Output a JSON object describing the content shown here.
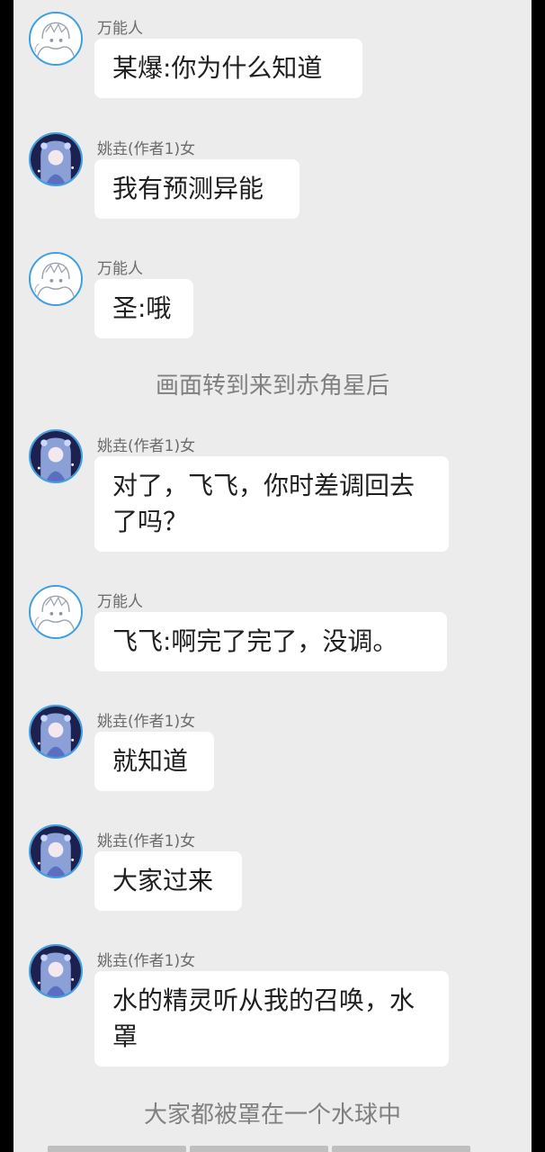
{
  "messages": [
    {
      "sender": "万能人",
      "avatar": "sketch-character-avatar",
      "text": "某爆:你为什么知道"
    },
    {
      "sender": "姚垚(作者1)女",
      "avatar": "anime-girl-avatar",
      "text": "我有预测异能"
    },
    {
      "sender": "万能人",
      "avatar": "sketch-character-avatar",
      "text": "圣:哦"
    },
    {
      "sender": "姚垚(作者1)女",
      "avatar": "anime-girl-avatar",
      "text": "对了，飞飞，你时差调回去了吗？"
    },
    {
      "sender": "万能人",
      "avatar": "sketch-character-avatar",
      "text": "飞飞:啊完了完了，没调。"
    },
    {
      "sender": "姚垚(作者1)女",
      "avatar": "anime-girl-avatar",
      "text": "就知道"
    },
    {
      "sender": "姚垚(作者1)女",
      "avatar": "anime-girl-avatar",
      "text": "大家过来"
    },
    {
      "sender": "姚垚(作者1)女",
      "avatar": "anime-girl-avatar",
      "text": "水的精灵听从我的召唤，水罩"
    }
  ],
  "narrations": [
    "画面转到来到赤角星后",
    "大家都被罩在一个水球中"
  ],
  "colors": {
    "background": "#ececec",
    "bubble": "#ffffff",
    "avatar_ring": "#3ea0e4",
    "narration_text": "#808080"
  }
}
